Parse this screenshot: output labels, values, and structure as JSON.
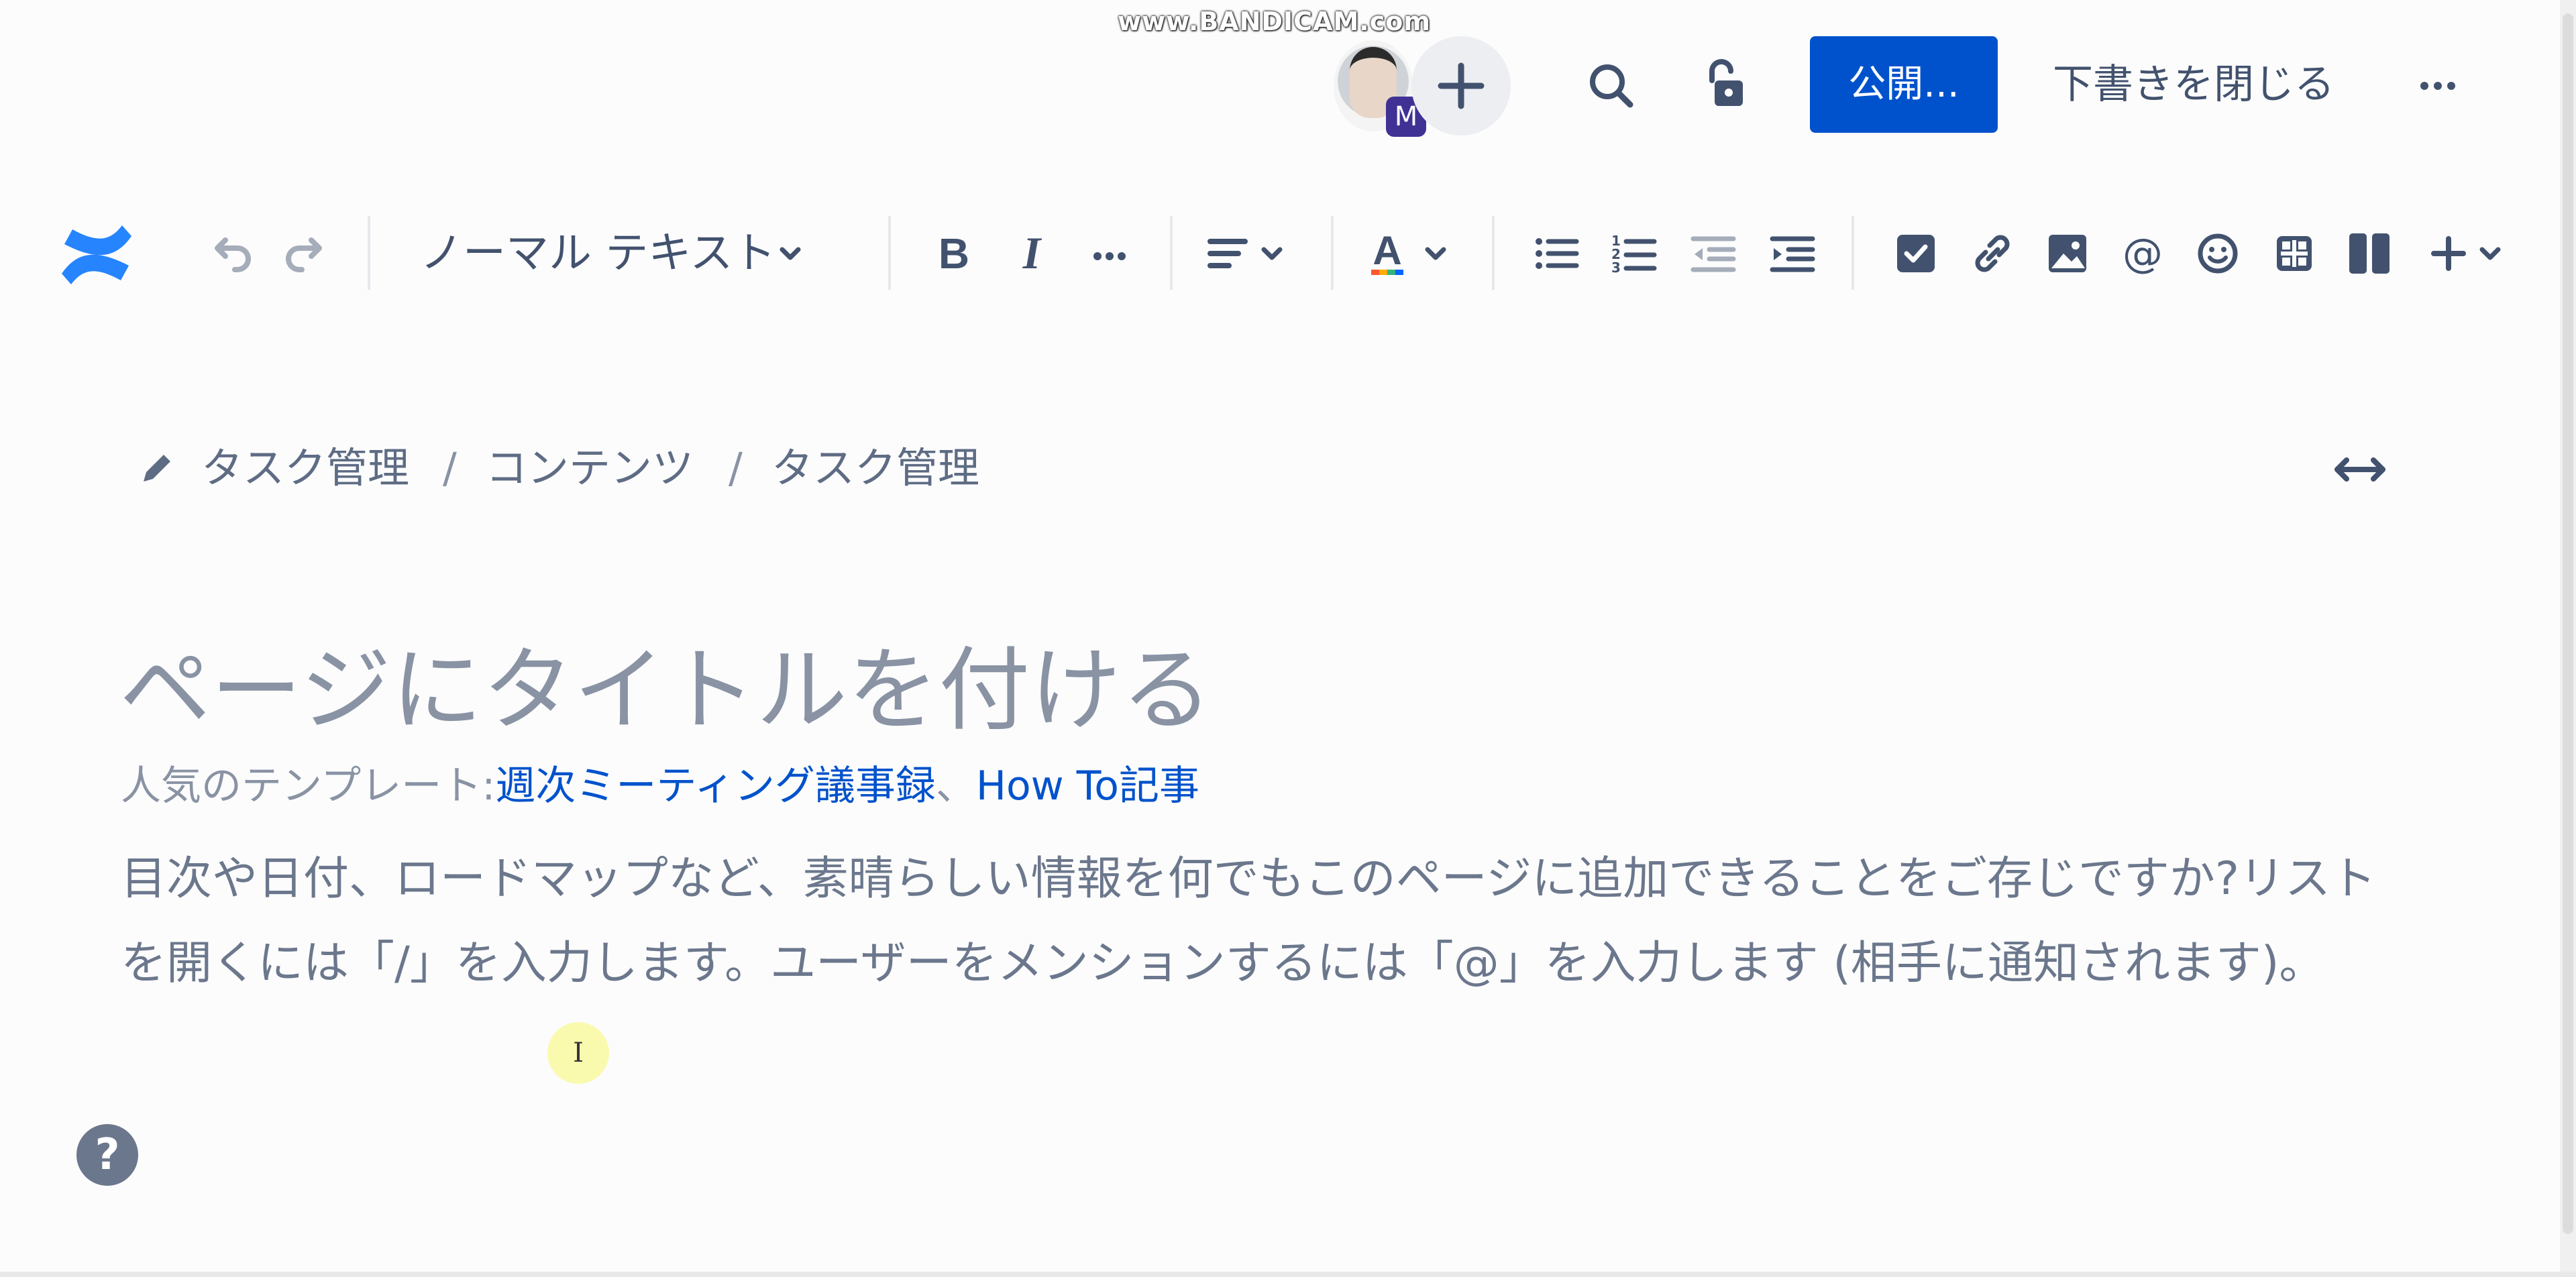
{
  "watermark": "www.BANDICAM.com",
  "header": {
    "avatar_badge": "M",
    "add_collaborator_icon": "plus-icon",
    "search_icon": "search-icon",
    "restrictions_icon": "unlock-icon",
    "publish_label": "公開...",
    "close_draft_label": "下書きを閉じる",
    "more_icon": "more-horizontal-icon",
    "accent_color": "#0052cc"
  },
  "toolbar": {
    "logo": "confluence-logo",
    "undo_icon": "undo-icon",
    "redo_icon": "redo-icon",
    "text_style": "ノーマル テキスト",
    "bold_icon": "bold-icon",
    "italic_icon": "italic-icon",
    "more_formatting_icon": "more-formatting-icon",
    "alignment_icon": "align-left-icon",
    "text_color_icon": "text-color-icon",
    "bullet_list_icon": "bullet-list-icon",
    "numbered_list_icon": "numbered-list-icon",
    "outdent_icon": "outdent-icon",
    "indent_icon": "indent-icon",
    "action_item_icon": "checkbox-icon",
    "link_icon": "link-icon",
    "image_icon": "image-icon",
    "mention_icon": "mention-icon",
    "emoji_icon": "emoji-icon",
    "table_icon": "table-icon",
    "layout_icon": "layout-columns-icon",
    "insert_icon": "plus-icon"
  },
  "breadcrumb": {
    "items": [
      "タスク管理",
      "コンテンツ",
      "タスク管理"
    ],
    "separator": "/"
  },
  "editor": {
    "title_placeholder": "ページにタイトルを付ける",
    "templates_label": "人気のテンプレート:",
    "templates": [
      "週次ミーティング議事録",
      "How To記事"
    ],
    "template_separator": "、",
    "hint_text": "目次や日付、ロードマップなど、素晴らしい情報を何でもこのページに追加できることをご存じですか?リストを開くには「/」を入力します。ユーザーをメンションするには「@」を入力します (相手に通知されます)。",
    "cursor_glyph": "I"
  },
  "help_label": "?"
}
